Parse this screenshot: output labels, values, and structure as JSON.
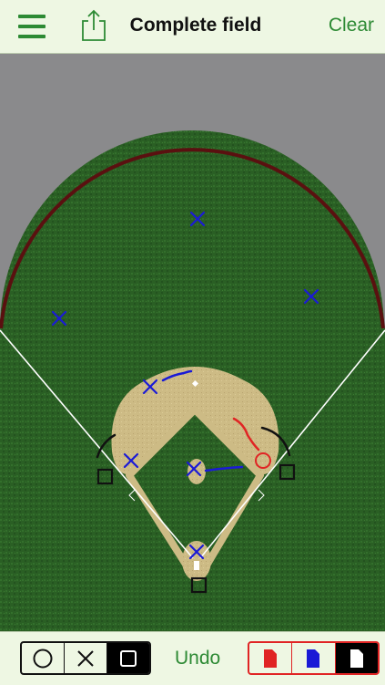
{
  "header": {
    "title": "Complete field",
    "clear_label": "Clear",
    "menu_icon": "hamburger-menu-icon",
    "share_icon": "share-icon"
  },
  "colors": {
    "accent_green": "#2d8a34",
    "grass": "#2a5f24",
    "dirt": "#cdbb85",
    "wall": "#5a1010",
    "background_gray": "#8a8a8c",
    "bar_background": "#eef7e3",
    "red_marker": "#e02424",
    "blue_marker": "#1a1ad6",
    "black_marker": "#111111"
  },
  "toolbar": {
    "undo_label": "Undo",
    "shape_options": [
      {
        "name": "circle",
        "icon": "circle-icon",
        "selected": false
      },
      {
        "name": "x",
        "icon": "x-icon",
        "selected": false
      },
      {
        "name": "square",
        "icon": "square-icon",
        "selected": true
      }
    ],
    "color_options": [
      {
        "name": "red",
        "icon": "red-document-icon",
        "selected": false
      },
      {
        "name": "blue",
        "icon": "blue-document-icon",
        "selected": false
      },
      {
        "name": "black",
        "icon": "black-document-icon",
        "selected": true
      }
    ]
  }
}
